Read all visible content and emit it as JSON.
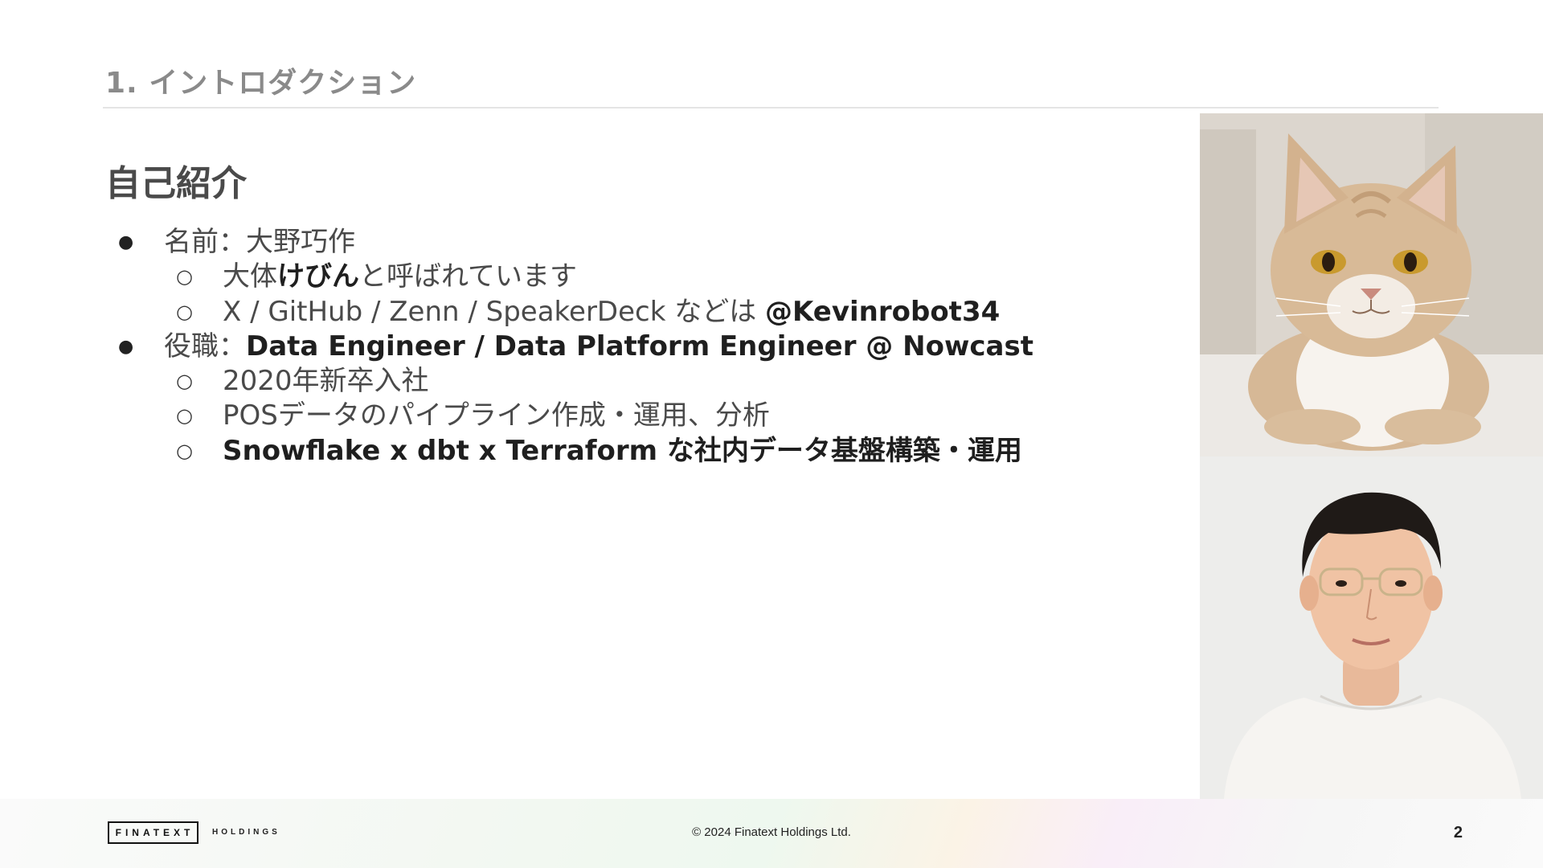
{
  "slide": {
    "section_title": "1. イントロダクション",
    "heading": "自己紹介",
    "bullets": {
      "name_label": "名前：",
      "name_value": "大野巧作",
      "nickname_prefix": "大体",
      "nickname_bold": "けびん",
      "nickname_suffix": "と呼ばれています",
      "accounts_prefix": "X / GitHub / Zenn / SpeakerDeck などは ",
      "accounts_handle": "@Kevinrobot34",
      "role_label": "役職：",
      "role_value": "Data Engineer / Data Platform Engineer @ Nowcast",
      "joined": "2020年新卒入社",
      "pos_work": "POSデータのパイプライン作成・運用、分析",
      "platform_work": "Snowflake x dbt x Terraform な社内データ基盤構築・運用"
    },
    "markers": {
      "level1": "●",
      "level2": "○"
    }
  },
  "footer": {
    "logo_text": "FINATEXT",
    "logo_sub": "HOLDINGS",
    "copyright": "© 2024 Finatext Holdings Ltd.",
    "page_number": "2"
  },
  "icons": {
    "cat_photo": "cat-photo",
    "person_photo": "person-photo"
  }
}
